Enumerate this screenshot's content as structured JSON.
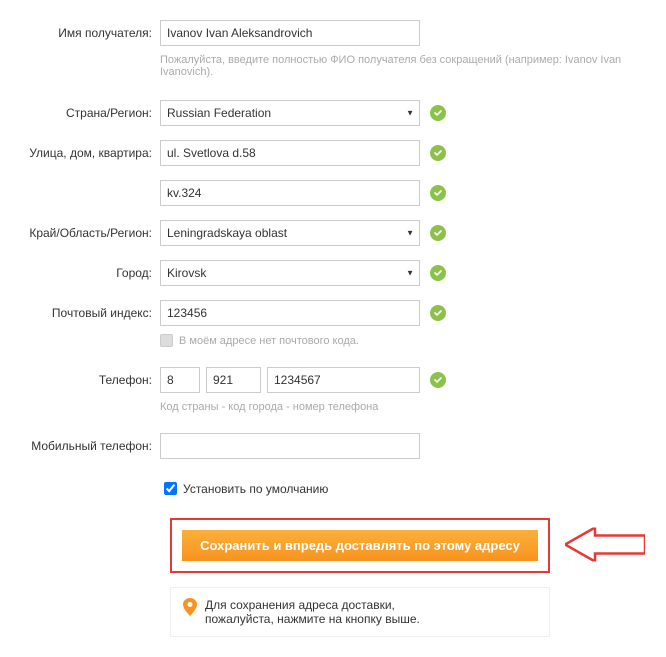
{
  "labels": {
    "recipient": "Имя получателя:",
    "country": "Страна/Регион:",
    "street": "Улица, дом, квартира:",
    "region": "Край/Область/Регион:",
    "city": "Город:",
    "postal": "Почтовый индекс:",
    "phone": "Телефон:",
    "mobile": "Мобильный телефон:"
  },
  "values": {
    "recipient": "Ivanov Ivan Aleksandrovich",
    "country": "Russian Federation",
    "street1": "ul. Svetlova d.58",
    "street2": "kv.324",
    "region": "Leningradskaya oblast",
    "city": "Kirovsk",
    "postal": "123456",
    "phone_country": "8",
    "phone_city": "921",
    "phone_number": "1234567",
    "mobile": ""
  },
  "hints": {
    "recipient": "Пожалуйста, введите полностью ФИО получателя без сокращений (например: Ivanov Ivan Ivanovich).",
    "no_postal": "В моём адресе нет почтового кода.",
    "phone": "Код страны - код города - номер телефона"
  },
  "default_checkbox": {
    "checked": true,
    "label": "Установить по умолчанию"
  },
  "submit_label": "Сохранить и впредь доставлять по этому адресу",
  "notice": {
    "line1": "Для сохранения адреса доставки,",
    "line2": "пожалуйста, нажмите на кнопку выше."
  },
  "colors": {
    "accent": "#f7931e",
    "highlight": "#e53935",
    "valid": "#8bc34a"
  }
}
